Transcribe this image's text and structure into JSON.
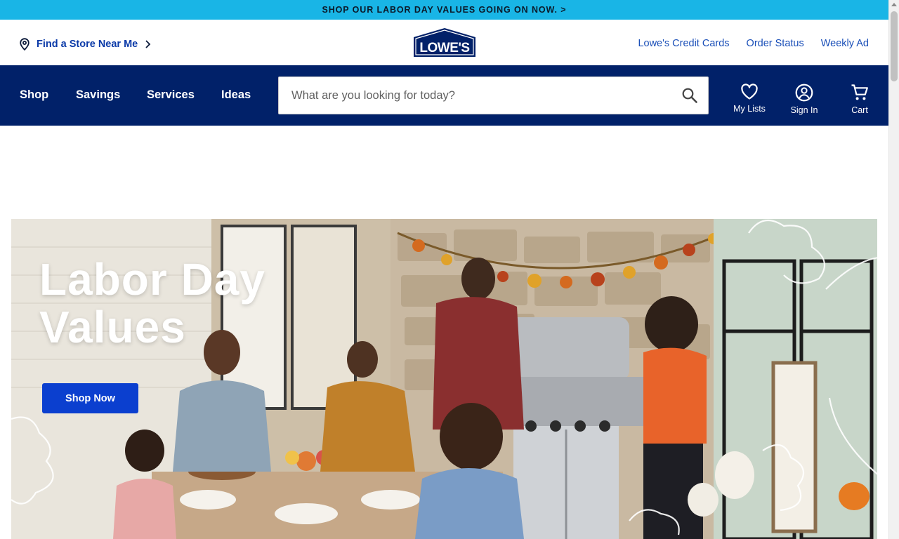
{
  "promo": {
    "text": "SHOP OUR LABOR DAY VALUES GOING ON NOW. >"
  },
  "header": {
    "store_link": "Find a Store Near Me",
    "logo_text": "LOWE'S",
    "links": [
      "Lowe's Credit Cards",
      "Order Status",
      "Weekly Ad"
    ]
  },
  "nav": {
    "items": [
      "Shop",
      "Savings",
      "Services",
      "Ideas"
    ],
    "search_placeholder": "What are you looking for today?",
    "actions": {
      "lists": "My Lists",
      "signin": "Sign In",
      "cart": "Cart"
    }
  },
  "hero": {
    "title_line1": "Labor Day",
    "title_line2": "Values",
    "cta": "Shop Now"
  },
  "colors": {
    "promo_bg": "#19b5e6",
    "nav_bg": "#012169",
    "link": "#1a4fb8",
    "cta": "#0b3fcf"
  },
  "icons": [
    "location-pin-icon",
    "chevron-right-icon",
    "search-icon",
    "heart-icon",
    "user-icon",
    "cart-icon"
  ]
}
